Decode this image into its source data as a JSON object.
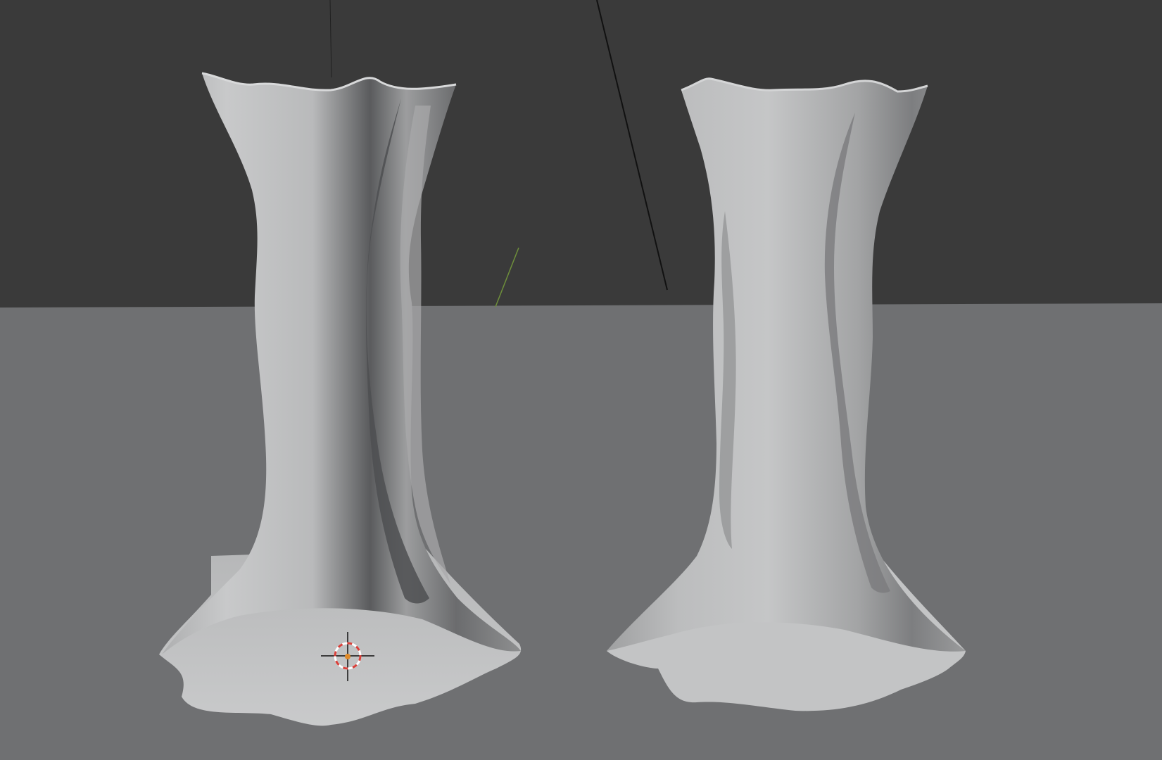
{
  "viewport": {
    "type": "3d-viewport",
    "shading": "solid",
    "colors": {
      "background": "#3a3a3a",
      "ground_plane": "#6f7072",
      "mesh_light": "#c6c7c8",
      "mesh_mid": "#a6a7a8",
      "mesh_dark": "#4e4f51",
      "edge_line": "#1b1b1b",
      "y_axis": "#6e8f3a",
      "cursor_ring_red": "#d9403a",
      "cursor_center": "#e08a28"
    }
  },
  "objects": [
    {
      "name": "vase-left",
      "kind": "mesh"
    },
    {
      "name": "vase-right",
      "kind": "mesh"
    }
  ],
  "cursor": {
    "icon": "3d-cursor-icon"
  }
}
